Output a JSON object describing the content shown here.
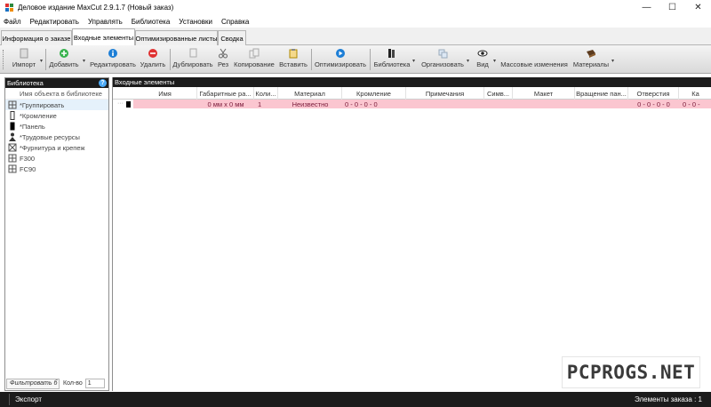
{
  "window": {
    "title": "Деловое издание MaxCut 2.9.1.7 (Новый заказ)",
    "controls": [
      "—",
      "☐",
      "✕"
    ]
  },
  "menu": [
    "Файл",
    "Редактировать",
    "Управлять",
    "Библиотека",
    "Установки",
    "Справка"
  ],
  "tabs": [
    "Информация о заказе",
    "Входные элементы",
    "Оптимизированные листы",
    "Сводка"
  ],
  "active_tab": "Входные элементы",
  "toolbar": {
    "import": "Импорт",
    "add": "Добавить",
    "edit": "Редактировать",
    "delete": "Удалить",
    "duplicate": "Дублировать",
    "cut": "Рез",
    "copy": "Копирование",
    "paste": "Вставить",
    "optimize": "Оптимизировать",
    "library": "Библиотека",
    "organize": "Организовать",
    "view": "Вид",
    "mass_changes": "Массовые изменения",
    "materials": "Материалы"
  },
  "library_panel": {
    "title": "Библиотека",
    "help": "?",
    "column": "Имя объекта в библиотеке",
    "items": [
      "*Группировать",
      "*Кромление",
      "*Панель",
      "*Трудовые ресурсы",
      "*Фурнитура и крепеж",
      "F300",
      "FC90"
    ],
    "filter_label": "Фильтровать б",
    "qty_label": "Кол-во",
    "qty_value": "1"
  },
  "main_panel": {
    "title": "Входные элементы",
    "columns": [
      "Имя",
      "Габаритные ра...",
      "Коли...",
      "Материал",
      "Кромление",
      "Примечания",
      "Симв...",
      "Макет",
      "Вращение пан...",
      "Отверстия",
      "Ка"
    ],
    "row": {
      "name": "",
      "dims": "0 мм x 0 мм",
      "qty": "1",
      "material": "Неизвестно",
      "edging": "0 - 0 - 0 - 0",
      "holes": "0 - 0 - 0 - 0",
      "extra": "0 - 0 -"
    }
  },
  "statusbar": {
    "export": "Экспорт",
    "order_items": "Элементы заказа : 1"
  },
  "watermark": "PCPROGS.NET",
  "colors": {
    "row_highlight": "#fbc6d0",
    "panel_header": "#1c1c1c",
    "row_text": "#7a1b3a"
  }
}
